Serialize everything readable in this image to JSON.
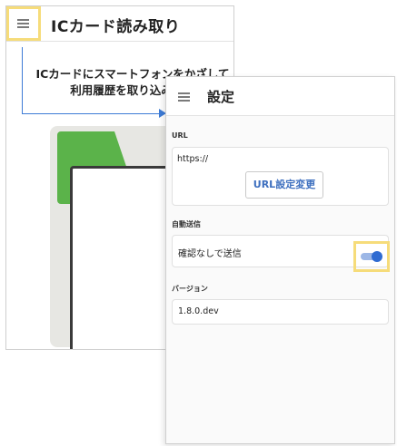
{
  "back_screen": {
    "title": "ICカード読み取り",
    "instruction_line1": "ICカードにスマートフォンをかざして",
    "instruction_line2": "利用履歴を取り込みます",
    "menu_icon": "hamburger-menu-icon"
  },
  "settings": {
    "title": "設定",
    "menu_icon": "hamburger-menu-icon",
    "url_label": "URL",
    "url_value": "https://",
    "url_button": "URL設定変更",
    "auto_send_label": "自動送信",
    "auto_send_option": "確認なしで送信",
    "auto_send_enabled": true,
    "version_label": "バージョン",
    "version_value": "1.8.0.dev"
  },
  "colors": {
    "accent": "#2f6bd1",
    "highlight": "#f6dc7a",
    "illustration_green": "#5bb34a"
  }
}
